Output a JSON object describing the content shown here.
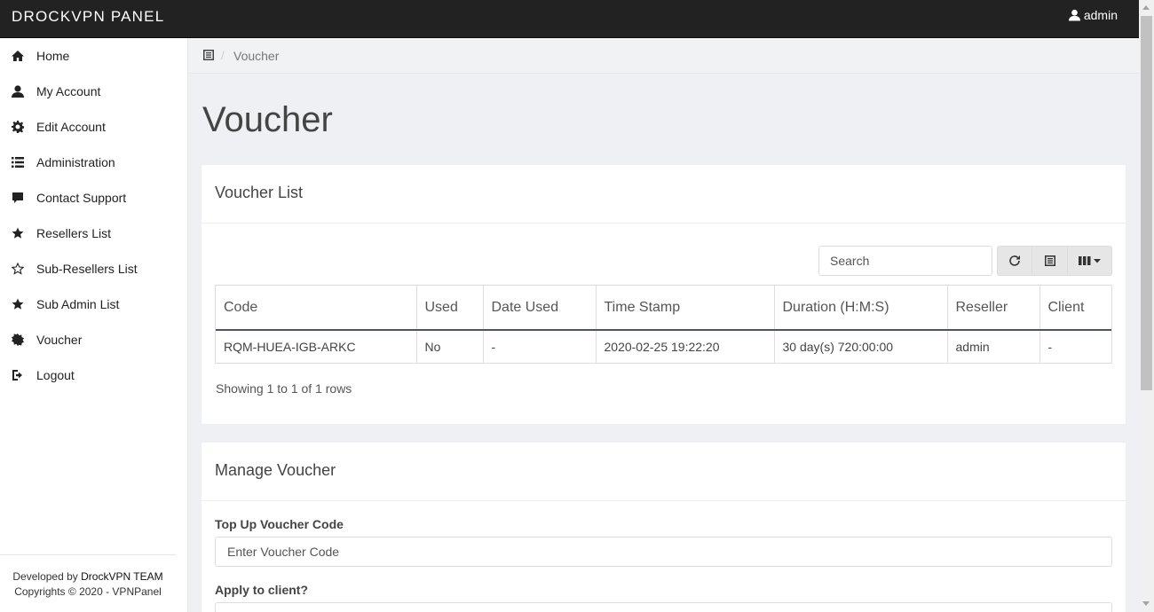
{
  "brand": "DROCKVPN PANEL",
  "user": {
    "name": "admin",
    "icon": "user-icon"
  },
  "sidebar": {
    "items": [
      {
        "label": "Home",
        "icon": "home-icon"
      },
      {
        "label": "My Account",
        "icon": "user-icon"
      },
      {
        "label": "Edit Account",
        "icon": "gear-icon"
      },
      {
        "label": "Administration",
        "icon": "list-icon"
      },
      {
        "label": "Contact Support",
        "icon": "comment-icon"
      },
      {
        "label": "Resellers List",
        "icon": "star-icon"
      },
      {
        "label": "Sub-Resellers List",
        "icon": "star-outline-icon"
      },
      {
        "label": "Sub Admin List",
        "icon": "star-icon"
      },
      {
        "label": "Voucher",
        "icon": "certificate-icon"
      },
      {
        "label": "Logout",
        "icon": "logout-icon"
      }
    ],
    "footer": {
      "line1_prefix": "Developed by",
      "line1_team": "DrockVPN TEAM",
      "line2": "Copyrights © 2020 - VPNPanel"
    }
  },
  "breadcrumb": {
    "current": "Voucher"
  },
  "page_title": "Voucher",
  "voucher_list": {
    "title": "Voucher List",
    "search_placeholder": "Search",
    "columns": [
      "Code",
      "Used",
      "Date Used",
      "Time Stamp",
      "Duration (H:M:S)",
      "Reseller",
      "Client"
    ],
    "rows": [
      {
        "code": "RQM-HUEA-IGB-ARKC",
        "used": "No",
        "date_used": "-",
        "timestamp": "2020-02-25 19:22:20",
        "duration": "30 day(s) 720:00:00",
        "reseller": "admin",
        "client": "-"
      }
    ],
    "showing": "Showing 1 to 1 of 1 rows"
  },
  "manage_voucher": {
    "title": "Manage Voucher",
    "code_label": "Top Up Voucher Code",
    "code_placeholder": "Enter Voucher Code",
    "client_label": "Apply to client?"
  }
}
